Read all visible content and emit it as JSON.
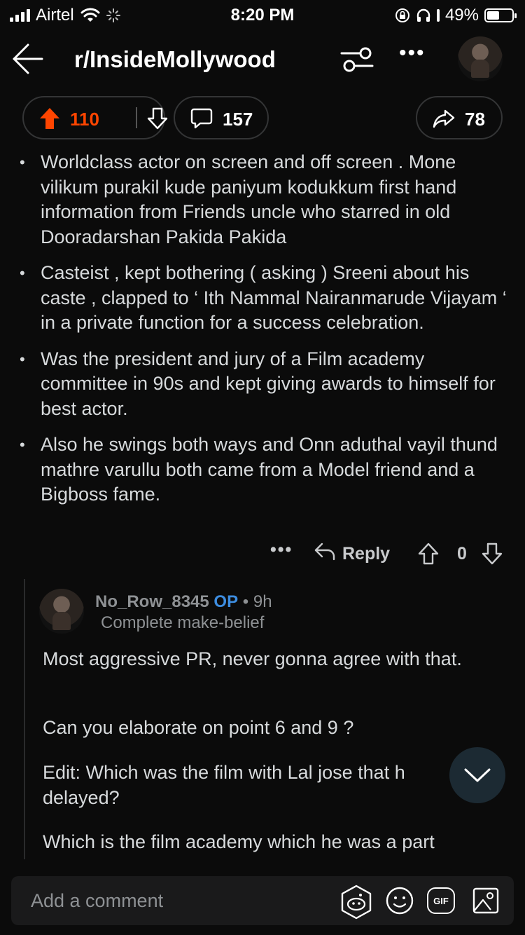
{
  "status_bar": {
    "carrier": "Airtel",
    "time": "8:20 PM",
    "battery": "49%",
    "battery_level": 0.49,
    "icons": [
      "signal-icon",
      "wifi-icon",
      "loading-icon",
      "lock-rotation-icon",
      "headphones-icon",
      "battery-icon"
    ]
  },
  "header": {
    "title": "r/InsideMollywood",
    "icons": [
      "back-arrow-icon",
      "filter-icon",
      "more-icon",
      "avatar"
    ]
  },
  "post_actions": {
    "upvotes": "110",
    "comments": "157",
    "shares": "78",
    "accent_color": "#ff4500"
  },
  "comment": {
    "bullets": [
      "Worldclass actor on screen and off screen . Mone vilikum purakil kude paniyum kodukkum first hand information from Friends uncle who starred in old Dooradarshan Pakida Pakida",
      "Casteist , kept bothering ( asking ) Sreeni about his caste , clapped to ‘ Ith Nammal Nairanmarude Vijayam ‘ in a private function for a success celebration.",
      "Was the president and jury of a Film academy committee in 90s and kept giving awards to himself for best actor.",
      "Also he swings both ways and Onn aduthal vayil thund mathre varullu both came from a Model friend and a Bigboss fame."
    ],
    "actions": {
      "more": "•••",
      "reply": "Reply",
      "score": "0"
    }
  },
  "reply": {
    "username": "No_Row_8345",
    "op_badge": "OP",
    "separator": "•",
    "age": "9h",
    "flair": "Complete make-belief",
    "paragraphs": [
      "Most aggressive PR, never gonna agree with that.",
      "Can you elaborate on point 6 and 9 ?",
      "Edit: Which was the film with Lal jose that h",
      "delayed?",
      "Which is the film academy which he was a part"
    ]
  },
  "composer": {
    "placeholder": "Add a comment",
    "gif_label": "GIF"
  }
}
